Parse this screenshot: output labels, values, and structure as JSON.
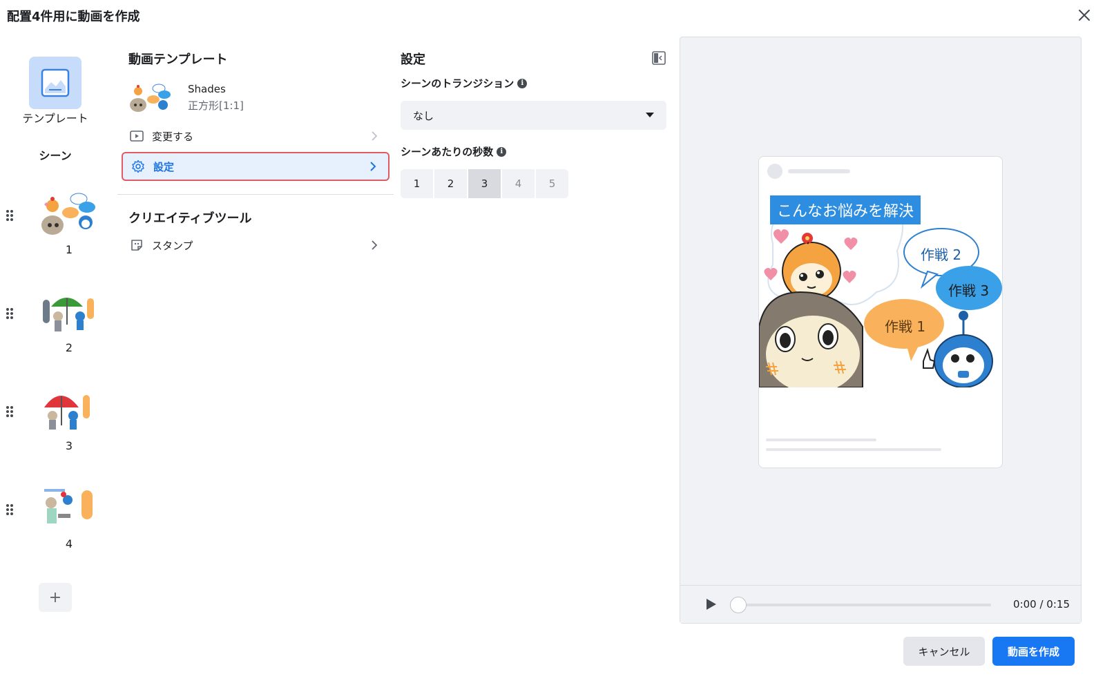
{
  "dialog": {
    "title": "配置4件用に動画を作成"
  },
  "left": {
    "template_label": "テンプレート",
    "scenes_heading": "シーン",
    "scenes": [
      {
        "number": "1"
      },
      {
        "number": "2"
      },
      {
        "number": "3"
      },
      {
        "number": "4"
      }
    ],
    "add_label": "+"
  },
  "template_panel": {
    "title": "動画テンプレート",
    "template_name": "Shades",
    "template_ratio": "正方形[1:1]",
    "change_label": "変更する",
    "settings_label": "設定"
  },
  "creative_tools": {
    "title": "クリエイティブツール",
    "stamp_label": "スタンプ"
  },
  "settings": {
    "title": "設定",
    "transition_label": "シーンのトランジション",
    "transition_value": "なし",
    "seconds_label": "シーンあたりの秒数",
    "seconds_options": [
      "1",
      "2",
      "3",
      "4",
      "5"
    ],
    "seconds_selected": "3"
  },
  "preview": {
    "banner_text": "こんなお悩みを解決",
    "bubbles": [
      "作戦 2",
      "作戦 3",
      "作戦 1"
    ],
    "time": "0:00 / 0:15",
    "progress": 0
  },
  "footer": {
    "cancel_label": "キャンセル",
    "create_label": "動画を作成"
  },
  "colors": {
    "primary": "#1877f2",
    "active_border": "#e05a66",
    "banner": "#2d8de0"
  }
}
